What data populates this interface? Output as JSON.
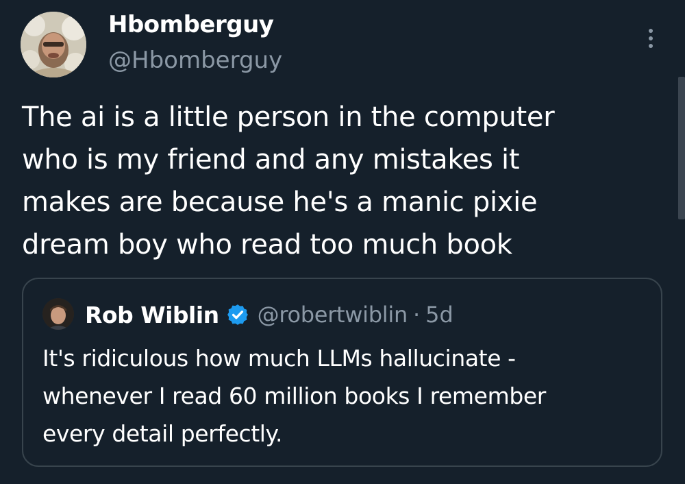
{
  "tweet": {
    "author_name": "Hbomberguy",
    "author_handle": "@Hbomberguy",
    "text_lines": [
      "The ai is a little person in the computer",
      "who is my friend and any mistakes it",
      "makes are because he's a manic pixie",
      "dream boy who read too much book"
    ],
    "more_icon": "more-vertical-icon"
  },
  "quote": {
    "author_name": "Rob Wiblin",
    "verified_icon": "verified-badge-icon",
    "author_handle": "@robertwiblin",
    "separator": "·",
    "time": "5d",
    "text_lines": [
      "It's ridiculous how much LLMs hallucinate -",
      "whenever I read 60 million books I remember",
      "every detail perfectly."
    ]
  },
  "colors": {
    "background": "#15202b",
    "text": "#ffffff",
    "secondary_text": "#8b98a5",
    "border": "#38444d",
    "verified": "#1d9bf0"
  }
}
